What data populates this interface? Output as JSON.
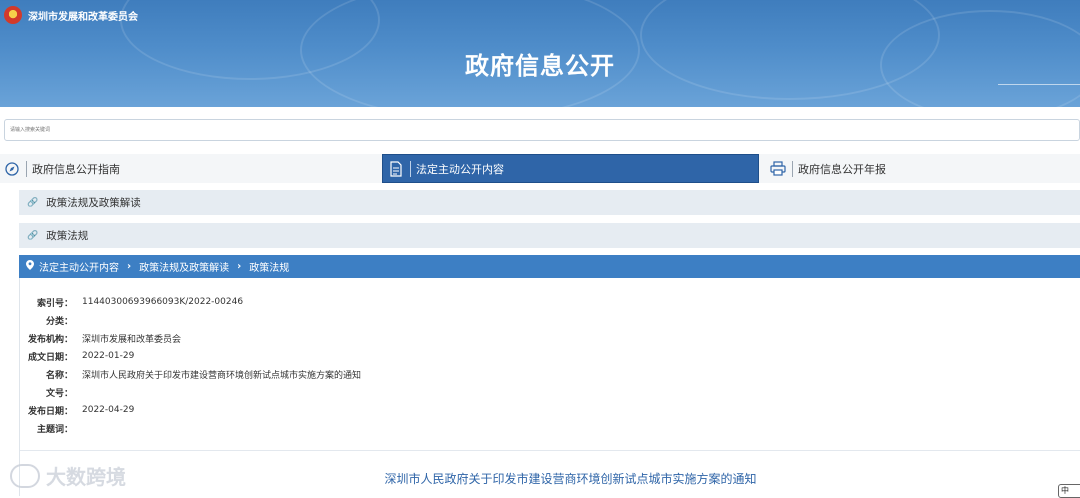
{
  "header": {
    "org_name": "深圳市发展和改革委员会",
    "page_title": "政府信息公开"
  },
  "search": {
    "placeholder": "请输入搜索关键词"
  },
  "tabs": [
    {
      "label": "政府信息公开指南",
      "icon": "compass-icon",
      "active": false
    },
    {
      "label": "法定主动公开内容",
      "icon": "document-icon",
      "active": true
    },
    {
      "label": "政府信息公开年报",
      "icon": "printer-icon",
      "active": false
    }
  ],
  "categories": [
    {
      "label": "政策法规及政策解读",
      "icon": "link-icon"
    },
    {
      "label": "政策法规",
      "icon": "link-icon"
    }
  ],
  "breadcrumb": {
    "icon": "location-pin-icon",
    "items": [
      "法定主动公开内容",
      "政策法规及政策解读",
      "政策法规"
    ]
  },
  "metadata": [
    {
      "label": "索引号：",
      "value": "11440300693966093K/2022-00246"
    },
    {
      "label": "分类：",
      "value": ""
    },
    {
      "label": "发布机构：",
      "value": "深圳市发展和改革委员会"
    },
    {
      "label": "成文日期：",
      "value": "2022-01-29"
    },
    {
      "label": "名称：",
      "value": "深圳市人民政府关于印发市建设营商环境创新试点城市实施方案的通知"
    },
    {
      "label": "文号：",
      "value": ""
    },
    {
      "label": "发布日期：",
      "value": "2022-04-29"
    },
    {
      "label": "主题词：",
      "value": ""
    }
  ],
  "document": {
    "title": "深圳市人民政府关于印发市建设营商环境创新试点城市实施方案的通知"
  },
  "watermark": {
    "text": "大数跨境"
  },
  "widget": {
    "text": "中"
  },
  "colors": {
    "banner": "#4f8dca",
    "active_tab": "#2f65a8",
    "breadcrumb": "#3d7fc4",
    "category_bg": "#e6ecf2",
    "doc_title": "#2f65a8"
  }
}
